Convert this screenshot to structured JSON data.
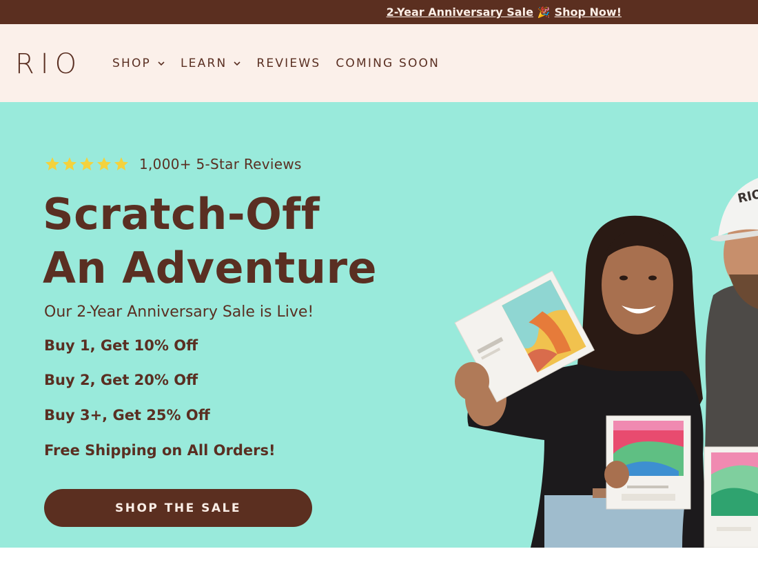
{
  "announcement": {
    "text": "2-Year Anniversary Sale",
    "emoji": "🎉",
    "link": "Shop Now!"
  },
  "header": {
    "logo": "RIO",
    "nav": [
      {
        "label": "SHOP",
        "has_dropdown": true
      },
      {
        "label": "LEARN",
        "has_dropdown": true
      },
      {
        "label": "REVIEWS",
        "has_dropdown": false
      },
      {
        "label": "COMING SOON",
        "has_dropdown": false
      }
    ]
  },
  "hero": {
    "rating": {
      "stars": 5,
      "text": "1,000+ 5-Star Reviews"
    },
    "headline": [
      "Scratch-Off",
      "An Adventure"
    ],
    "subhead": "Our 2-Year Anniversary Sale is Live!",
    "offers": [
      "Buy 1, Get 10% Off",
      "Buy 2, Get 20% Off",
      "Buy 3+, Get 25% Off",
      "Free Shipping on All Orders!"
    ],
    "cta": "SHOP THE SALE",
    "hat_logo": "RIO"
  },
  "colors": {
    "brand_brown": "#5b2f20",
    "cream": "#fbf0ea",
    "hero_mint": "#99eadb",
    "star_yellow": "#f4d23c"
  }
}
